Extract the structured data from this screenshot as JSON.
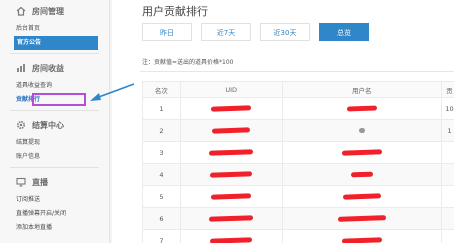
{
  "sidebar": {
    "sections": [
      {
        "title": "房间管理",
        "icon": "home-icon",
        "items": [
          {
            "label": "后台首页"
          },
          {
            "label": "官方公告"
          }
        ]
      },
      {
        "title": "房间收益",
        "icon": "bar-chart-icon",
        "items": [
          {
            "label": "道具收益查询"
          },
          {
            "label": "贡献排行"
          }
        ]
      },
      {
        "title": "结算中心",
        "icon": "gear-icon",
        "items": [
          {
            "label": "结算提现"
          },
          {
            "label": "账户信息"
          }
        ]
      },
      {
        "title": "直播",
        "icon": "monitor-icon",
        "items": [
          {
            "label": "订阅推送"
          },
          {
            "label": "直播弹幕开启/关闭"
          },
          {
            "label": "添加本地直播"
          }
        ]
      }
    ]
  },
  "main": {
    "title": "用户贡献排行",
    "tabs": [
      {
        "label": "昨日"
      },
      {
        "label": "近7天"
      },
      {
        "label": "近30天"
      },
      {
        "label": "总览"
      }
    ],
    "active_tab": "总览",
    "note": "注：贡献值=送出的道具价格*100",
    "table": {
      "headers": [
        "名次",
        "UID",
        "用户名",
        "贡"
      ],
      "rows": [
        {
          "rank": "1",
          "last": "10"
        },
        {
          "rank": "2",
          "last": "1"
        },
        {
          "rank": "3",
          "last": ""
        },
        {
          "rank": "4",
          "last": ""
        },
        {
          "rank": "5",
          "last": ""
        },
        {
          "rank": "6",
          "last": ""
        },
        {
          "rank": "7",
          "last": ""
        }
      ]
    }
  },
  "colors": {
    "accent": "#2f86c8",
    "redaction": "#f0212a",
    "highlight_box": "#b24fd6"
  }
}
